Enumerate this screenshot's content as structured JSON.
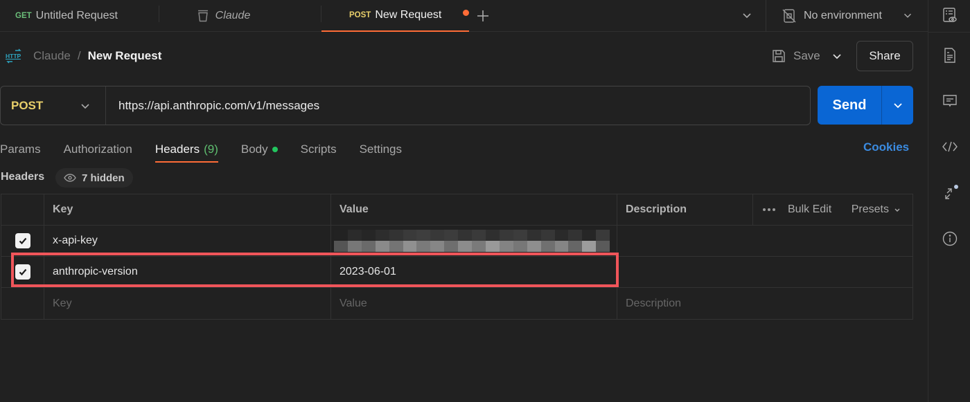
{
  "tabs": [
    {
      "method": "GET",
      "label": "Untitled Request"
    },
    {
      "icon": "collection-icon",
      "label": "Claude"
    },
    {
      "method": "POST",
      "label": "New Request",
      "unsaved": true
    }
  ],
  "environment": {
    "label": "No environment"
  },
  "breadcrumb": {
    "parent": "Claude",
    "separator": "/",
    "current": "New Request"
  },
  "actions": {
    "save": "Save",
    "share": "Share"
  },
  "request": {
    "method": "POST",
    "url": "https://api.anthropic.com/v1/messages",
    "send": "Send"
  },
  "request_tabs": [
    {
      "label": "Params"
    },
    {
      "label": "Authorization"
    },
    {
      "label": "Headers",
      "count": "(9)",
      "active": true
    },
    {
      "label": "Body",
      "has_content": true
    },
    {
      "label": "Scripts"
    },
    {
      "label": "Settings"
    }
  ],
  "cookies": "Cookies",
  "headers_section": {
    "title": "Headers",
    "hidden": "7 hidden"
  },
  "table": {
    "columns": {
      "key": "Key",
      "value": "Value",
      "description": "Description"
    },
    "actions": {
      "bulk_edit": "Bulk Edit",
      "presets": "Presets"
    },
    "rows": [
      {
        "checked": true,
        "key": "x-api-key",
        "value": "[redacted]",
        "redacted": true
      },
      {
        "checked": true,
        "key": "anthropic-version",
        "value": "2023-06-01",
        "highlighted": true
      }
    ],
    "placeholder": {
      "key": "Key",
      "value": "Value",
      "description": "Description"
    }
  },
  "colors": {
    "accent": "#ff6c37",
    "send": "#0a66d4",
    "post": "#e8cf6a",
    "get": "#6bbf7a",
    "highlight": "#f0555a",
    "link": "#3b8be0"
  }
}
